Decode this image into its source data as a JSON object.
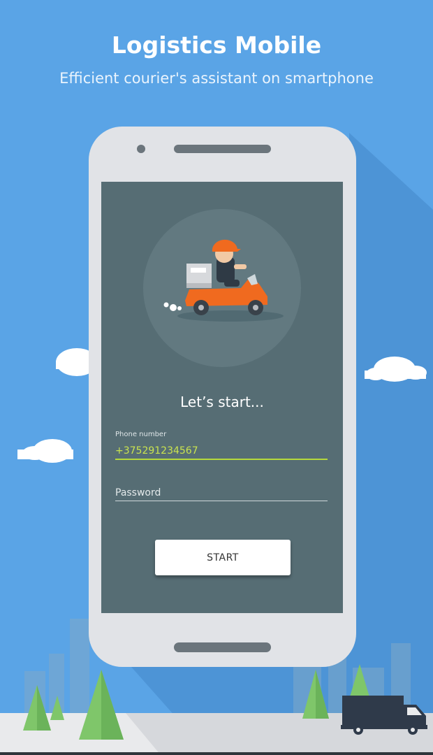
{
  "header": {
    "title": "Logistics Mobile",
    "subtitle": "Efficient courier's assistant on smartphone"
  },
  "login": {
    "heading": "Let’s start...",
    "phone_label": "Phone number",
    "phone_value": "+375291234567",
    "password_placeholder": "Password",
    "start_label": "START"
  },
  "icons": {
    "illustration": "courier-scooter-icon",
    "truck": "delivery-truck-icon"
  },
  "colors": {
    "sky": "#5aa4e6",
    "screen": "#566d74",
    "accent": "#f06a1f",
    "field_active": "#b6d93c",
    "phone_body": "#e1e3e7"
  }
}
